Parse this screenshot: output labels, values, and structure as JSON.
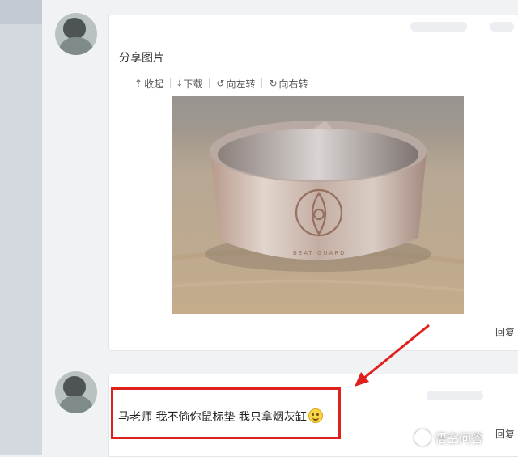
{
  "post": {
    "title": "分享图片",
    "toolbar": [
      {
        "label": "收起",
        "icon": "collapse-icon",
        "glyph": "⇡"
      },
      {
        "label": "下载",
        "icon": "download-icon",
        "glyph": "⤓"
      },
      {
        "label": "向左转",
        "icon": "rotate-left-icon",
        "glyph": "↺"
      },
      {
        "label": "向右转",
        "icon": "rotate-right-icon",
        "glyph": "↻"
      }
    ],
    "reply_label": "回复"
  },
  "comment": {
    "text": "马老师 我不偷你鼠标垫 我只拿烟灰缸",
    "reply_label": "回复"
  },
  "watermark": {
    "text": "悟空问答"
  },
  "colors": {
    "highlight": "#e0201d",
    "arrow": "#e0201d"
  }
}
